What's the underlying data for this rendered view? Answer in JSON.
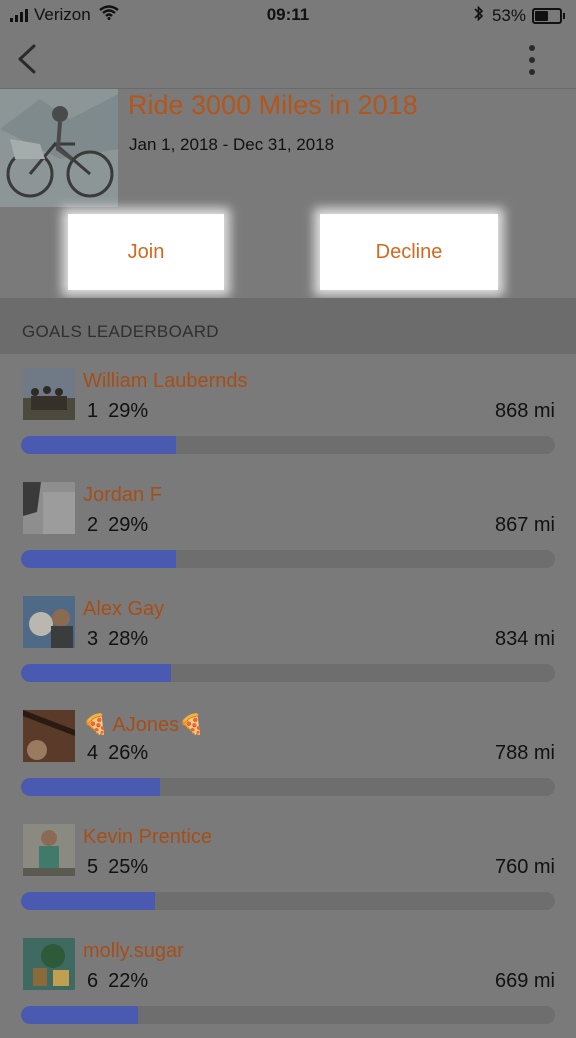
{
  "status_bar": {
    "carrier": "Verizon",
    "time": "09:11",
    "battery": "53%"
  },
  "nav": {
    "back_icon": "chevron-left-icon",
    "more_icon": "vertical-ellipsis-icon"
  },
  "challenge": {
    "title": "Ride 3000 Miles in 2018",
    "dates": "Jan 1, 2018 - Dec 31, 2018"
  },
  "actions": {
    "join_label": "Join",
    "decline_label": "Decline"
  },
  "leaderboard": {
    "header": "GOALS LEADERBOARD",
    "entries": [
      {
        "name": "William Laubernds",
        "rank": "1",
        "percent": "29%",
        "distance": "868 mi",
        "progress": 0.29
      },
      {
        "name": "Jordan F",
        "rank": "2",
        "percent": "29%",
        "distance": "867 mi",
        "progress": 0.29
      },
      {
        "name": "Alex Gay",
        "rank": "3",
        "percent": "28%",
        "distance": "834 mi",
        "progress": 0.28
      },
      {
        "name": "🍕 AJones🍕",
        "rank": "4",
        "percent": "26%",
        "distance": "788 mi",
        "progress": 0.26
      },
      {
        "name": "Kevin Prentice",
        "rank": "5",
        "percent": "25%",
        "distance": "760 mi",
        "progress": 0.25
      },
      {
        "name": "molly.sugar",
        "rank": "6",
        "percent": "22%",
        "distance": "669 mi",
        "progress": 0.22
      }
    ]
  },
  "colors": {
    "accent": "#d4681e",
    "progress_fill": "#4a5ab0",
    "background_dim": "#7a7a7a"
  }
}
